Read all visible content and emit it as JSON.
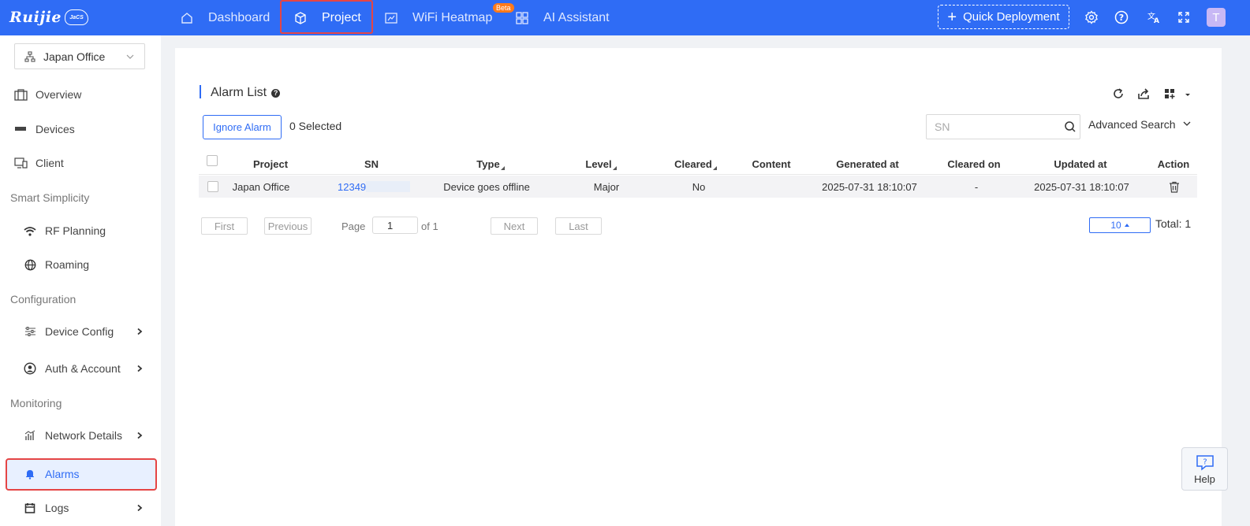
{
  "brand": {
    "name": "Ruijie",
    "sub": "JaCS"
  },
  "nav": [
    {
      "label": "Dashboard",
      "icon": "home-icon"
    },
    {
      "label": "Project",
      "icon": "cube-icon",
      "active": true
    },
    {
      "label": "WiFi Heatmap",
      "icon": "map-icon",
      "badge": "Beta"
    },
    {
      "label": "AI Assistant",
      "icon": "grid-icon"
    }
  ],
  "header": {
    "quick_deployment": "Quick Deployment",
    "avatar": "T"
  },
  "sidebar": {
    "project": "Japan Office",
    "items": [
      {
        "label": "Overview"
      },
      {
        "label": "Devices"
      },
      {
        "label": "Client"
      }
    ],
    "groups": {
      "smart": "Smart Simplicity",
      "config": "Configuration",
      "monitoring": "Monitoring"
    },
    "smart_items": [
      {
        "label": "RF Planning"
      },
      {
        "label": "Roaming"
      }
    ],
    "config_items": [
      {
        "label": "Device Config"
      },
      {
        "label": "Auth & Account"
      }
    ],
    "monitoring_items": [
      {
        "label": "Network Details"
      },
      {
        "label": "Alarms",
        "active": true
      },
      {
        "label": "Logs"
      }
    ]
  },
  "alarm": {
    "title": "Alarm List",
    "ignore_button": "Ignore Alarm",
    "selected": "0 Selected",
    "search_placeholder": "SN",
    "advanced_search": "Advanced Search",
    "columns": [
      "Project",
      "SN",
      "Type",
      "Level",
      "Cleared",
      "Content",
      "Generated at",
      "Cleared on",
      "Updated at",
      "Action"
    ],
    "rows": [
      {
        "project": "Japan Office",
        "sn": "12349",
        "type": "Device goes offline",
        "level": "Major",
        "cleared": "No",
        "content": "",
        "generated": "2025-07-31 18:10:07",
        "cleared_on": "-",
        "updated": "2025-07-31 18:10:07"
      }
    ]
  },
  "pagination": {
    "first": "First",
    "previous": "Previous",
    "page_label": "Page",
    "page": "1",
    "of": "of 1",
    "next": "Next",
    "last": "Last",
    "page_size": "10",
    "total": "Total: 1"
  },
  "help": "Help"
}
